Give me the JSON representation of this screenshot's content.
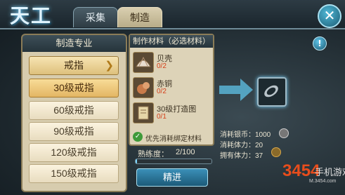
{
  "header": {
    "logo_text": "天工",
    "tabs": [
      {
        "label": "采集",
        "active": false
      },
      {
        "label": "制造",
        "active": true
      }
    ],
    "close_icon": "close-icon"
  },
  "categories": {
    "title": "制造专业",
    "items": [
      {
        "label": "戒指",
        "state": "expanded"
      },
      {
        "label": "30级戒指",
        "state": "selected"
      },
      {
        "label": "60级戒指",
        "state": "normal"
      },
      {
        "label": "90级戒指",
        "state": "normal"
      },
      {
        "label": "120级戒指",
        "state": "normal"
      },
      {
        "label": "150级戒指",
        "state": "normal"
      }
    ]
  },
  "materials": {
    "title": "制作材料（必选材料）",
    "items": [
      {
        "name": "贝壳",
        "count": "0/2",
        "icon": "shell-icon"
      },
      {
        "name": "赤铜",
        "count": "0/2",
        "icon": "copper-icon"
      },
      {
        "name": "30级打造图",
        "count": "0/1",
        "icon": "scroll-icon"
      }
    ],
    "bind_option": {
      "label": "优先消耗绑定材料",
      "checked": true
    }
  },
  "proficiency": {
    "label": "熟练度：",
    "value": "2/100",
    "fraction": 0.02
  },
  "craft_button": "精进",
  "help_button": "!",
  "result": {
    "icon": "ring-icon"
  },
  "costs": [
    {
      "label": "消耗银币：",
      "value": "1000"
    },
    {
      "label": "消耗体力：",
      "value": "20"
    },
    {
      "label": "拥有体力：",
      "value": "37"
    }
  ],
  "watermark": {
    "number": "3454",
    "text": "手机游戏",
    "url": "M.3454.com"
  },
  "colors": {
    "accent": "#7ed6ff",
    "material_count": "#d5401b",
    "selected_item": "#e3b664"
  }
}
